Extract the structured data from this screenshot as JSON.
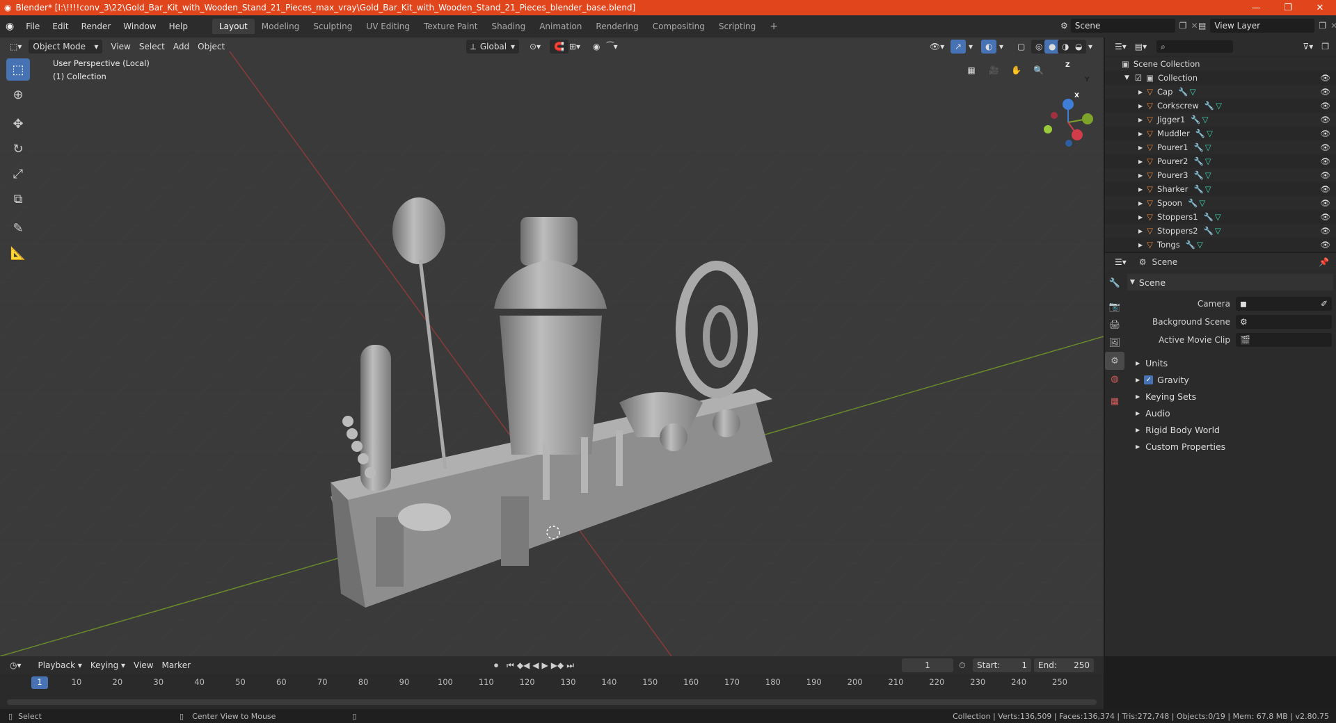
{
  "window": {
    "title": "Blender* [I:\\!!!!conv_3\\22\\Gold_Bar_Kit_with_Wooden_Stand_21_Pieces_max_vray\\Gold_Bar_Kit_with_Wooden_Stand_21_Pieces_blender_base.blend]"
  },
  "menus": [
    "File",
    "Edit",
    "Render",
    "Window",
    "Help"
  ],
  "workspaces": [
    "Layout",
    "Modeling",
    "Sculpting",
    "UV Editing",
    "Texture Paint",
    "Shading",
    "Animation",
    "Rendering",
    "Compositing",
    "Scripting"
  ],
  "scene_selector": "Scene",
  "view_layer": "View Layer",
  "viewport": {
    "mode": "Object Mode",
    "menus": [
      "View",
      "Select",
      "Add",
      "Object"
    ],
    "transform_orientation": "Global",
    "overlay_line1": "User Perspective (Local)",
    "overlay_line2": "(1) Collection",
    "gizmo": {
      "x": "X",
      "y": "Y",
      "z": "Z"
    }
  },
  "outliner": {
    "root": "Scene Collection",
    "collection": "Collection",
    "items": [
      "Cap",
      "Corkscrew",
      "Jigger1",
      "Muddler",
      "Pourer1",
      "Pourer2",
      "Pourer3",
      "Sharker",
      "Spoon",
      "Stoppers1",
      "Stoppers2",
      "Tongs"
    ]
  },
  "properties": {
    "header": "Scene",
    "section": "Scene",
    "fields": [
      {
        "label": "Camera"
      },
      {
        "label": "Background Scene"
      },
      {
        "label": "Active Movie Clip"
      }
    ],
    "panels": [
      "Units",
      "Gravity",
      "Keying Sets",
      "Audio",
      "Rigid Body World",
      "Custom Properties"
    ]
  },
  "timeline": {
    "menus": [
      "Playback",
      "Keying",
      "View",
      "Marker"
    ],
    "current_frame": "1",
    "start_label": "Start:",
    "start": "1",
    "end_label": "End:",
    "end": "250",
    "ticks": [
      "1",
      "10",
      "20",
      "30",
      "40",
      "50",
      "60",
      "70",
      "80",
      "90",
      "100",
      "110",
      "120",
      "130",
      "140",
      "150",
      "160",
      "170",
      "180",
      "190",
      "200",
      "210",
      "220",
      "230",
      "240",
      "250"
    ]
  },
  "status": {
    "left": "Select",
    "middle": "Center View to Mouse",
    "right": "Collection | Verts:136,509 | Faces:136,374 | Tris:272,748 | Objects:0/19 | Mem: 67.8 MB | v2.80.75"
  },
  "colors": {
    "title_bar": "#e0451c",
    "accent": "#4772b3",
    "mesh_icon": "#e8853a",
    "modifier_icon": "#6fa8dc",
    "data_icon": "#3fd4b0"
  }
}
